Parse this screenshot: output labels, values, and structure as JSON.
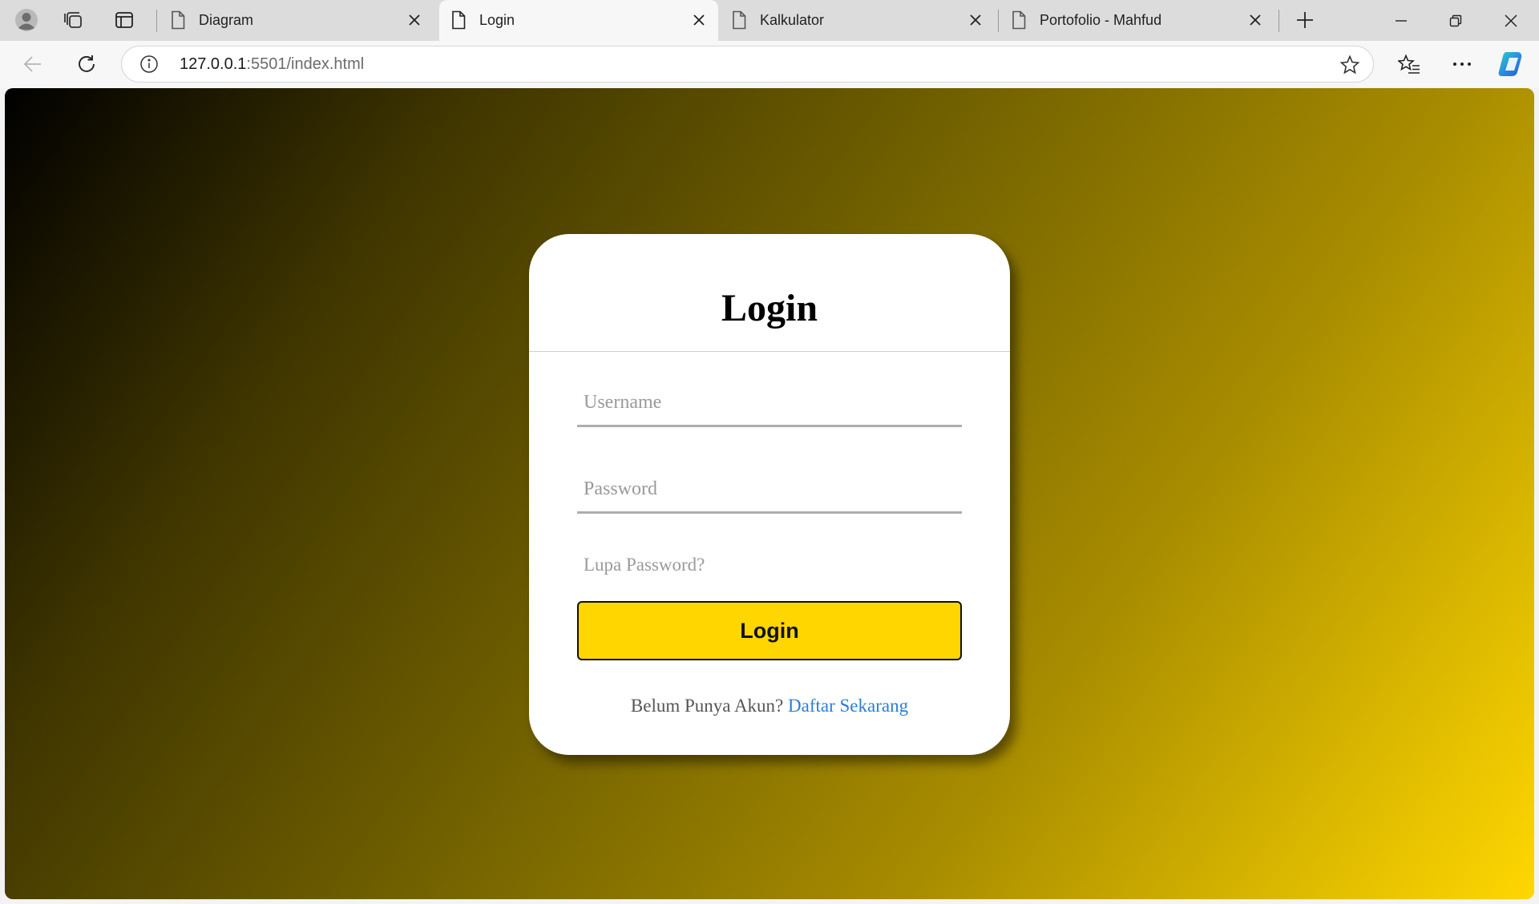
{
  "browser": {
    "tabs": [
      {
        "title": "Diagram",
        "active": false
      },
      {
        "title": "Login",
        "active": true
      },
      {
        "title": "Kalkulator",
        "active": false
      },
      {
        "title": "Portofolio - Mahfud",
        "active": false
      }
    ],
    "address": {
      "host": "127.0.0.1",
      "rest": ":5501/index.html"
    },
    "colors": {
      "copilot": "#2b8fe0"
    }
  },
  "page": {
    "title": "Login",
    "username_placeholder": "Username",
    "password_placeholder": "Password",
    "forgot_label": "Lupa Password?",
    "login_label": "Login",
    "signup_prompt": "Belum Punya Akun?",
    "signup_link": "Daftar Sekarang",
    "colors": {
      "button": "#ffd600",
      "link": "#2a7fd4",
      "gradient_start": "#000000",
      "gradient_end": "#ffd700"
    }
  }
}
